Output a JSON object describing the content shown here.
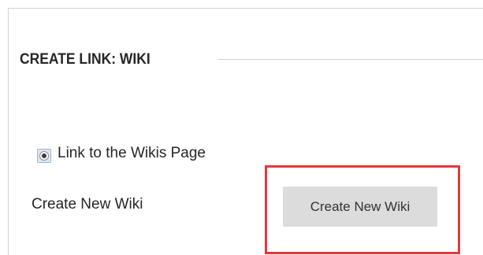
{
  "section": {
    "title": "CREATE LINK: WIKI"
  },
  "link_option": {
    "label": "Link to the Wikis Page",
    "selected": true,
    "icon": "radio-selected-icon"
  },
  "create_field": {
    "label": "Create New Wiki",
    "button_label": "Create New Wiki"
  },
  "colors": {
    "highlight_border": "#e5383b",
    "button_background": "#dcdcdc",
    "text": "#262626"
  }
}
